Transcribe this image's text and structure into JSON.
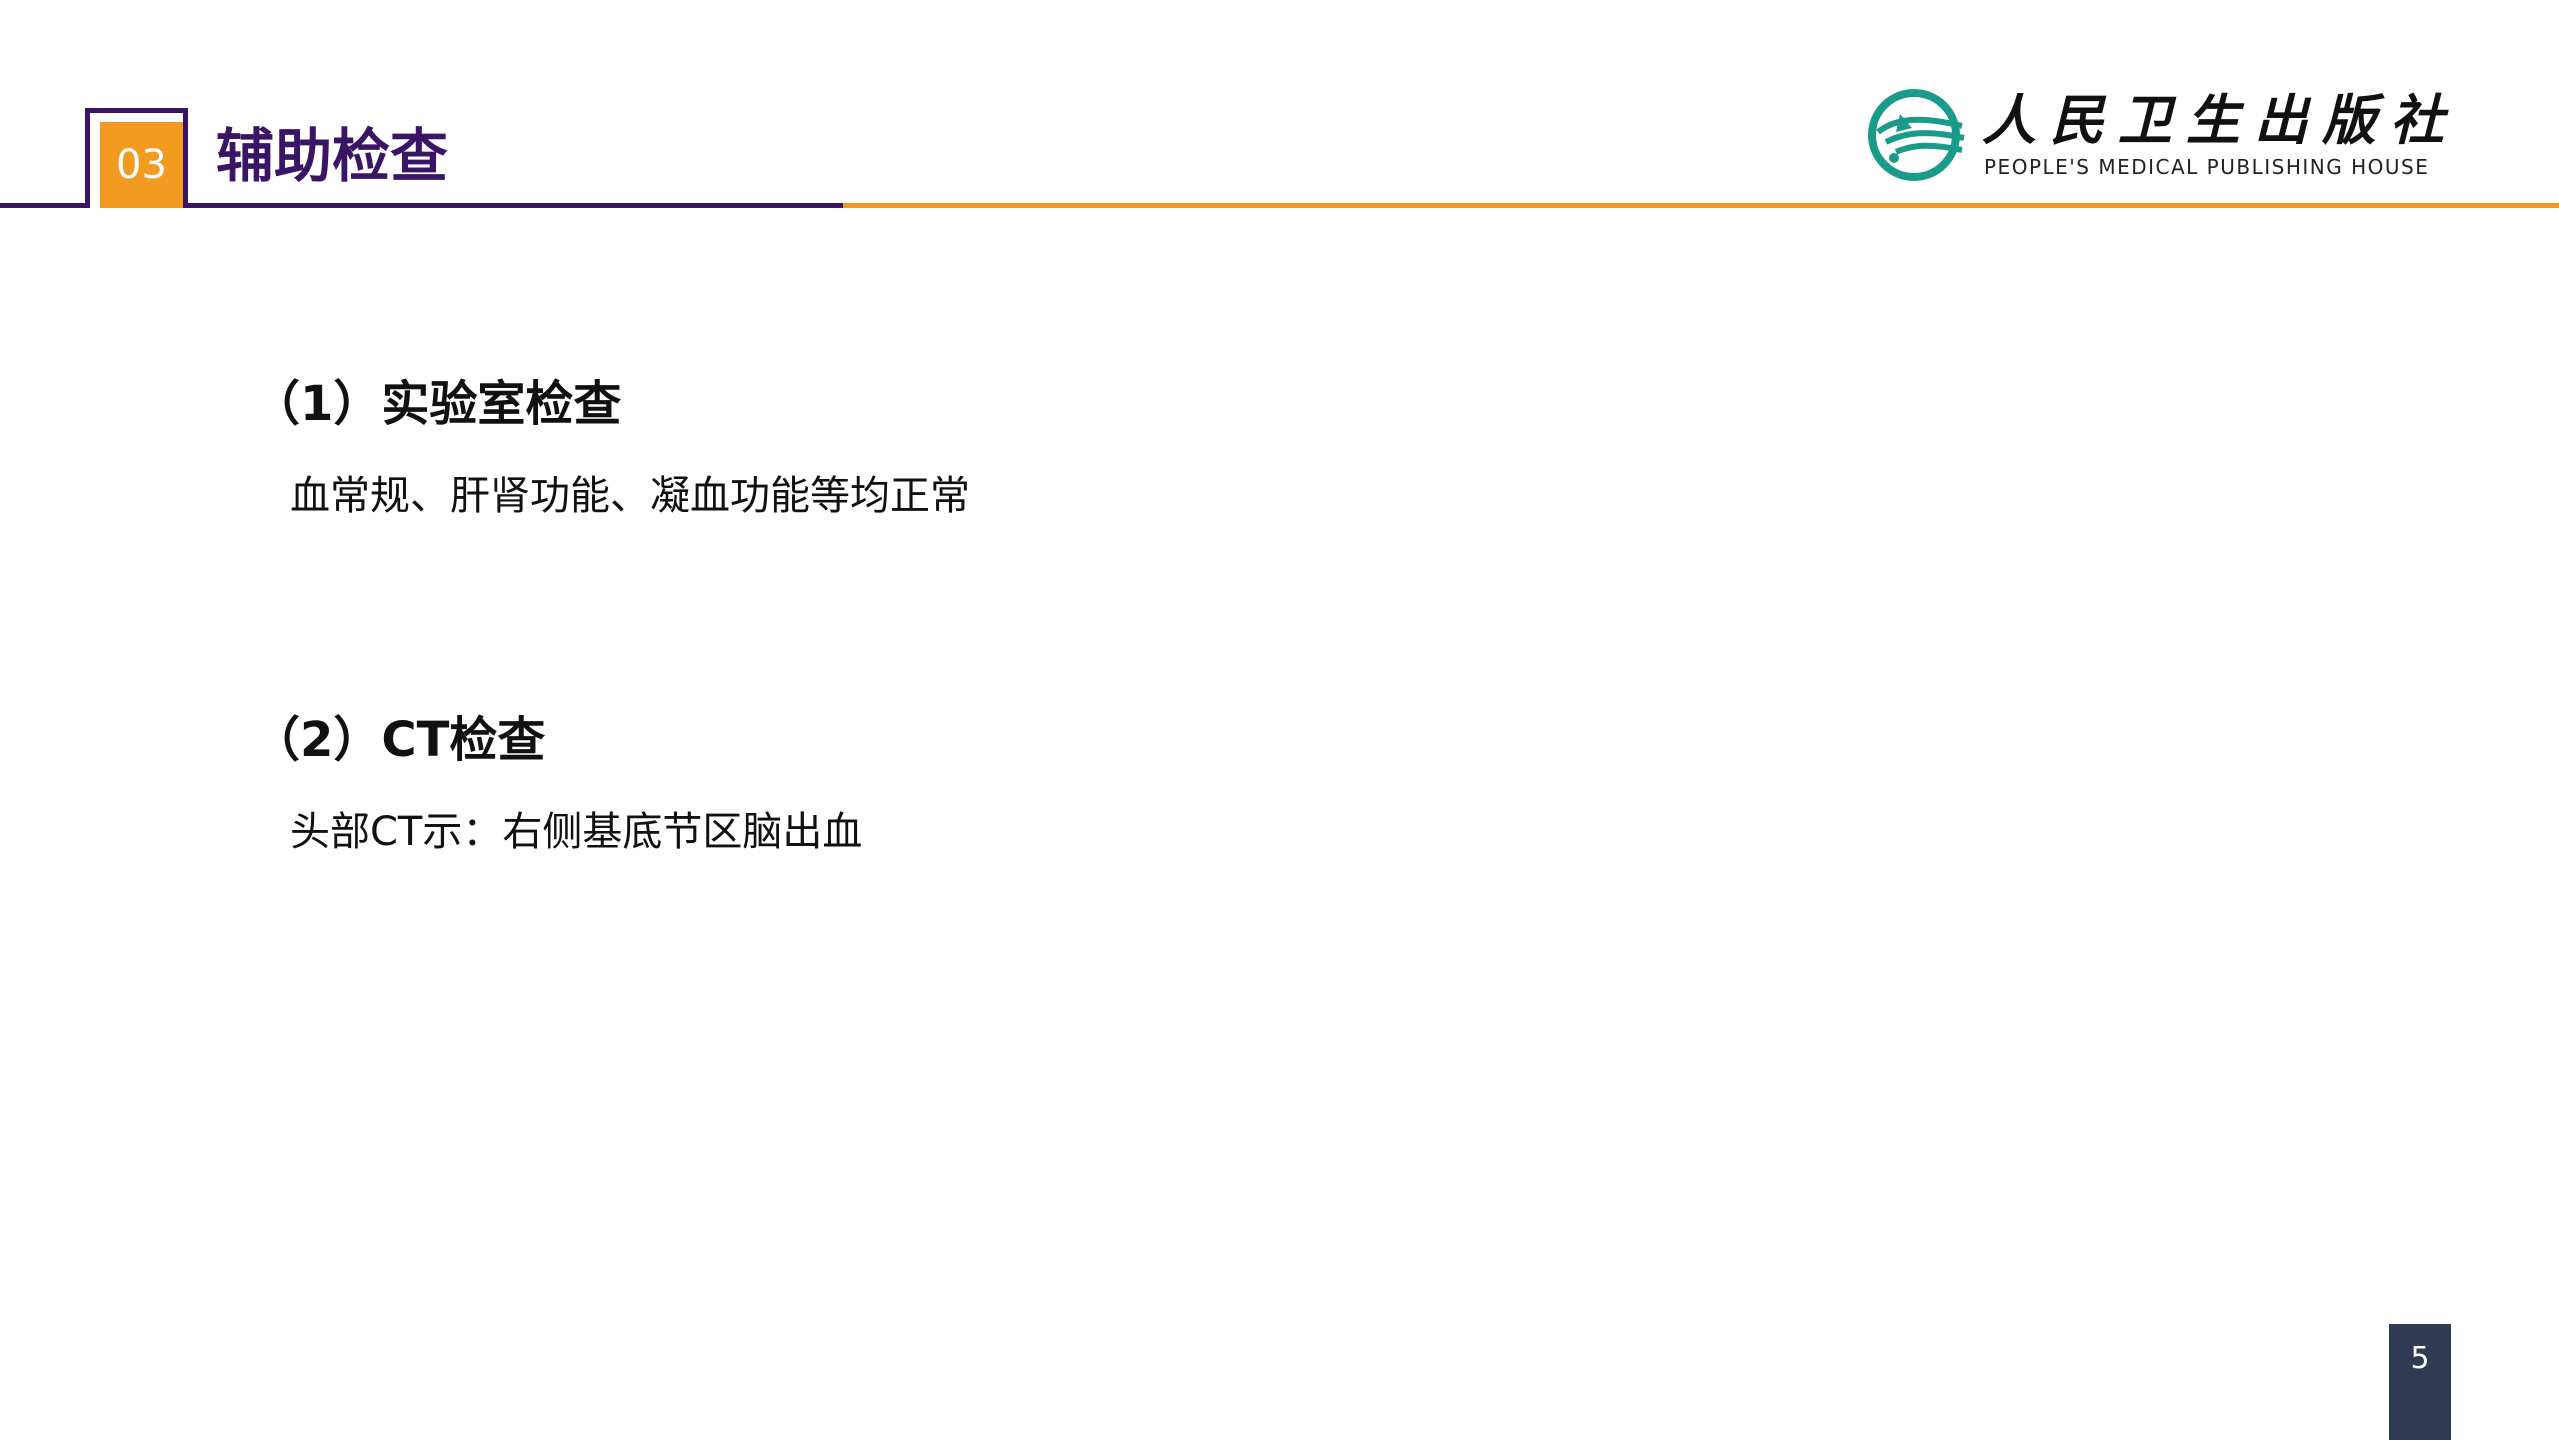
{
  "header": {
    "section_number": "03",
    "section_title": "辅助检查",
    "colors": {
      "purple": "#3a1566",
      "orange": "#f39a21",
      "logo_teal": "#1a9b8a"
    }
  },
  "logo": {
    "chinese_name": "人民卫生出版社",
    "english_name": "PEOPLE'S MEDICAL PUBLISHING HOUSE",
    "icon": "publisher-emblem-icon"
  },
  "content": {
    "items": [
      {
        "heading": "（1）实验室检查",
        "body": "血常规、肝肾功能、凝血功能等均正常"
      },
      {
        "heading": "（2）CT检查",
        "body": "头部CT示：右侧基底节区脑出血"
      }
    ]
  },
  "footer": {
    "page_number": "5"
  }
}
